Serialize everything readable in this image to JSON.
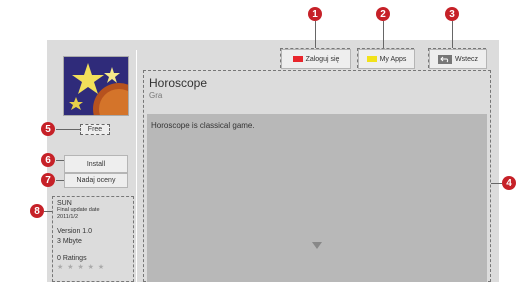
{
  "top_buttons": [
    {
      "label": "Zaloguj się",
      "color": "#e8262c"
    },
    {
      "label": "My Apps",
      "color": "#f2e21a"
    },
    {
      "label": "Wstecz",
      "icon": "back-icon"
    }
  ],
  "app": {
    "price": "Free",
    "install": "Install",
    "rate": "Nadaj oceny",
    "title": "Horoscope",
    "genre": "Gra",
    "description": "Horoscope is classical game."
  },
  "info": {
    "developer": "SUN",
    "update_label": "Final update date",
    "update_date": "2011/1/2",
    "version": "Version 1.0",
    "size": "3 Mbyte",
    "ratings": "0 Ratings",
    "stars": "★ ★ ★ ★ ★"
  },
  "callouts": [
    "1",
    "2",
    "3",
    "4",
    "5",
    "6",
    "7",
    "8"
  ]
}
